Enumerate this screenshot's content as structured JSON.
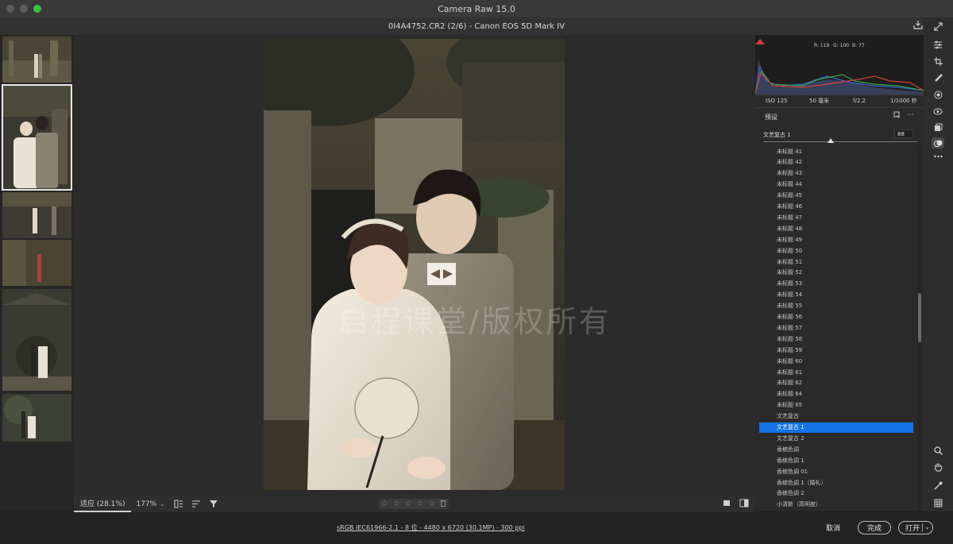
{
  "window": {
    "title": "Camera Raw 15.0"
  },
  "file": {
    "label": "0I4A4752.CR2 (2/6) -  Canon EOS 5D Mark IV"
  },
  "filmstrip": {
    "count": 6,
    "selected_index": 1
  },
  "canvas": {
    "watermark": "启程课堂/版权所有"
  },
  "bottom_toolbar": {
    "fit_label": "适应 (28.1%)",
    "zoom_label": "177%",
    "stars": [
      "☆",
      "☆",
      "☆",
      "☆",
      "☆"
    ]
  },
  "status": {
    "info": "sRGB IEC61966-2.1 - 8 位 - 4480 x 6720 (30.1MP) - 300 ppi",
    "cancel_label": "取消",
    "done_label": "完成",
    "open_label": "打开"
  },
  "histogram": {
    "r": "R: 119",
    "g": "G: 100",
    "b": "B: 77"
  },
  "meta": {
    "iso": "ISO 125",
    "focal": "50 毫米",
    "aperture": "f/2.2",
    "shutter": "1/1000 秒"
  },
  "presets": {
    "heading": "预设",
    "current_name": "文艺复古 1",
    "amount": "88",
    "amount_fraction": 0.44,
    "items": [
      "未标题 41",
      "未标题 42",
      "未标题 43",
      "未标题 44",
      "未标题 45",
      "未标题 46",
      "未标题 47",
      "未标题 48",
      "未标题 49",
      "未标题 50",
      "未标题 51",
      "未标题 52",
      "未标题 53",
      "未标题 54",
      "未标题 55",
      "未标题 56",
      "未标题 57",
      "未标题 58",
      "未标题 59",
      "未标题 60",
      "未标题 61",
      "未标题 62",
      "未标题 64",
      "未标题 65",
      "文艺复古",
      "文艺复古 1",
      "文艺复古 2",
      "香槟色调",
      "香槟色调 1",
      "香槟色调 01",
      "香槟色调 1（婚礼）",
      "香槟色调 2",
      "小清新（高明度）"
    ],
    "selected_index": 25
  },
  "colors": {
    "accent": "#1473e6",
    "panel": "#2a2a2a",
    "canvas": "#2b2b2b"
  },
  "tools": [
    "expand-icon",
    "sliders-icon",
    "crop-icon",
    "healing-icon",
    "mask-icon",
    "redeye-icon",
    "snapshot-icon",
    "presets-icon",
    "more-icon",
    "zoom-icon",
    "hand-icon",
    "sampler-icon",
    "grid-icon"
  ]
}
